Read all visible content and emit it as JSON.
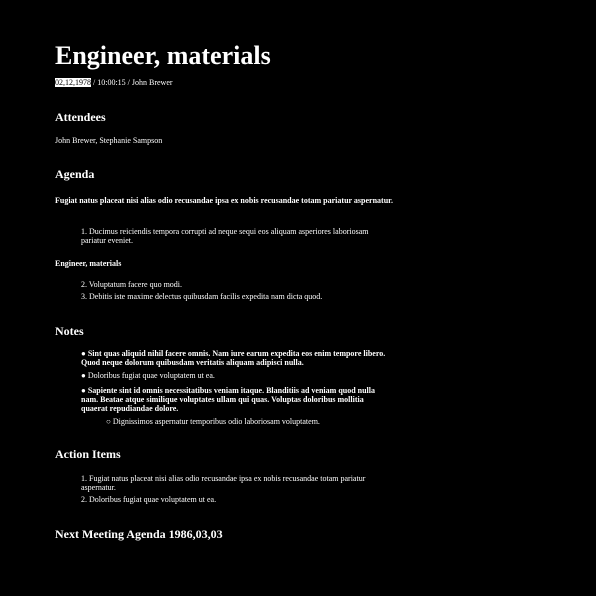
{
  "title": "Engineer, materials",
  "meta": {
    "date": "02,12,1978",
    "rest": " / 10:00:15 / John Brewer"
  },
  "attendees": {
    "heading": "Attendees",
    "text": "John Brewer, Stephanie Sampson"
  },
  "agenda": {
    "heading": "Agenda",
    "intro": "Fugiat natus placeat nisi alias odio recusandae ipsa ex nobis recusandae totam pariatur aspernatur.",
    "items1": [
      "1. Ducimus reiciendis tempora corrupti ad neque sequi eos aliquam asperiores laboriosam pariatur eveniet."
    ],
    "subheading": "Engineer, materials",
    "items2": [
      "2. Voluptatum facere quo modi.",
      "3. Debitis iste maxime delectus quibusdam facilis expedita nam dicta quod."
    ]
  },
  "notes": {
    "heading": "Notes",
    "bullets": [
      "● Sint quas aliquid nihil facere omnis. Nam iure earum expedita eos enim tempore libero. Quod neque dolorum quibusdam veritatis aliquam adipisci nulla.",
      "● Doloribus fugiat quae voluptatem ut ea.",
      "● Sapiente sint id omnis necessitatibus veniam itaque. Blanditiis ad veniam quod nulla nam. Beatae atque similique voluptates ullam qui quas. Voluptas doloribus mollitia quaerat repudiandae dolore."
    ],
    "sub": "○ Dignissimos aspernatur temporibus odio laboriosam voluptatem."
  },
  "actions": {
    "heading": "Action Items",
    "items": [
      "1. Fugiat natus placeat nisi alias odio recusandae ipsa ex nobis recusandae totam pariatur aspernatur.",
      "2. Doloribus fugiat quae voluptatem ut ea."
    ]
  },
  "next": {
    "heading": "Next Meeting Agenda 1986,03,03"
  }
}
